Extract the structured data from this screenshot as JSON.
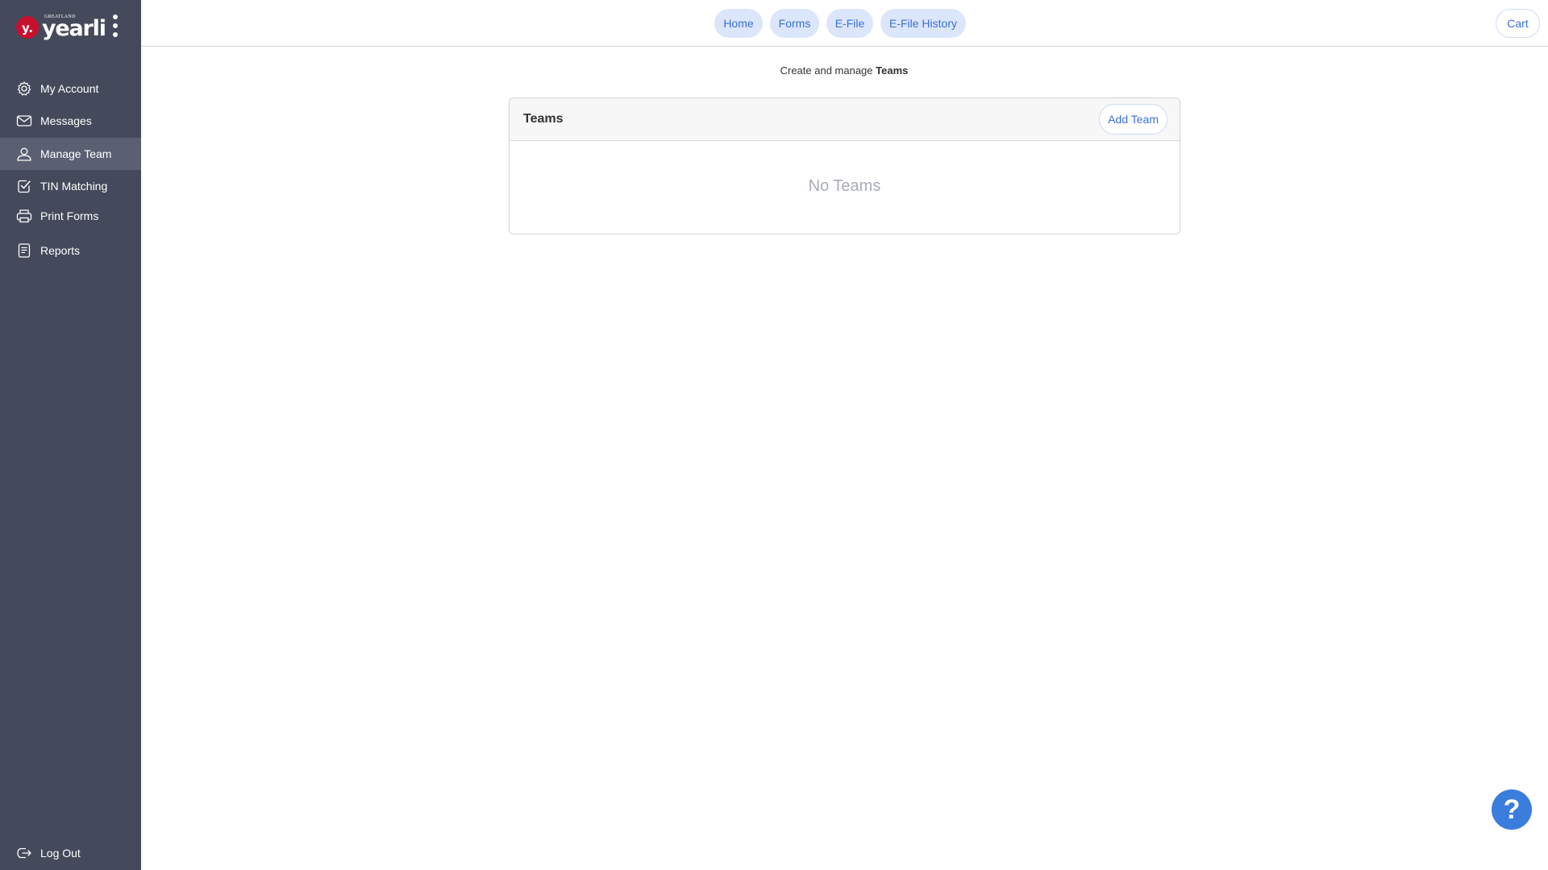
{
  "brand": {
    "super": "GREATLAND",
    "word": "yearli",
    "mark": "y."
  },
  "sidebar": {
    "items": [
      {
        "label": "My Account",
        "icon": "gear-icon",
        "active": false
      },
      {
        "label": "Messages",
        "icon": "envelope-icon",
        "active": false
      },
      {
        "label": "Manage Team",
        "icon": "user-icon",
        "active": true
      },
      {
        "label": "TIN Matching",
        "icon": "check-square-icon",
        "active": false
      },
      {
        "label": "Print Forms",
        "icon": "printer-icon",
        "active": false
      },
      {
        "label": "Reports",
        "icon": "document-icon",
        "active": false
      }
    ],
    "logout_label": "Log Out"
  },
  "topnav": {
    "tabs": [
      {
        "label": "Home"
      },
      {
        "label": "Forms"
      },
      {
        "label": "E-File"
      },
      {
        "label": "E-File History"
      }
    ],
    "cart_label": "Cart"
  },
  "main": {
    "subtitle_prefix": "Create and manage ",
    "subtitle_bold": "Teams",
    "card": {
      "title": "Teams",
      "add_label": "Add Team",
      "empty_text": "No Teams"
    }
  },
  "help": {
    "label": "?"
  },
  "colors": {
    "sidebar_bg": "#444a5b",
    "sidebar_active": "#5a6072",
    "accent": "#3b6fd8",
    "pill_bg": "#dbe6fb",
    "brand_red": "#c8102e",
    "help_bg": "#3b7ddd"
  }
}
